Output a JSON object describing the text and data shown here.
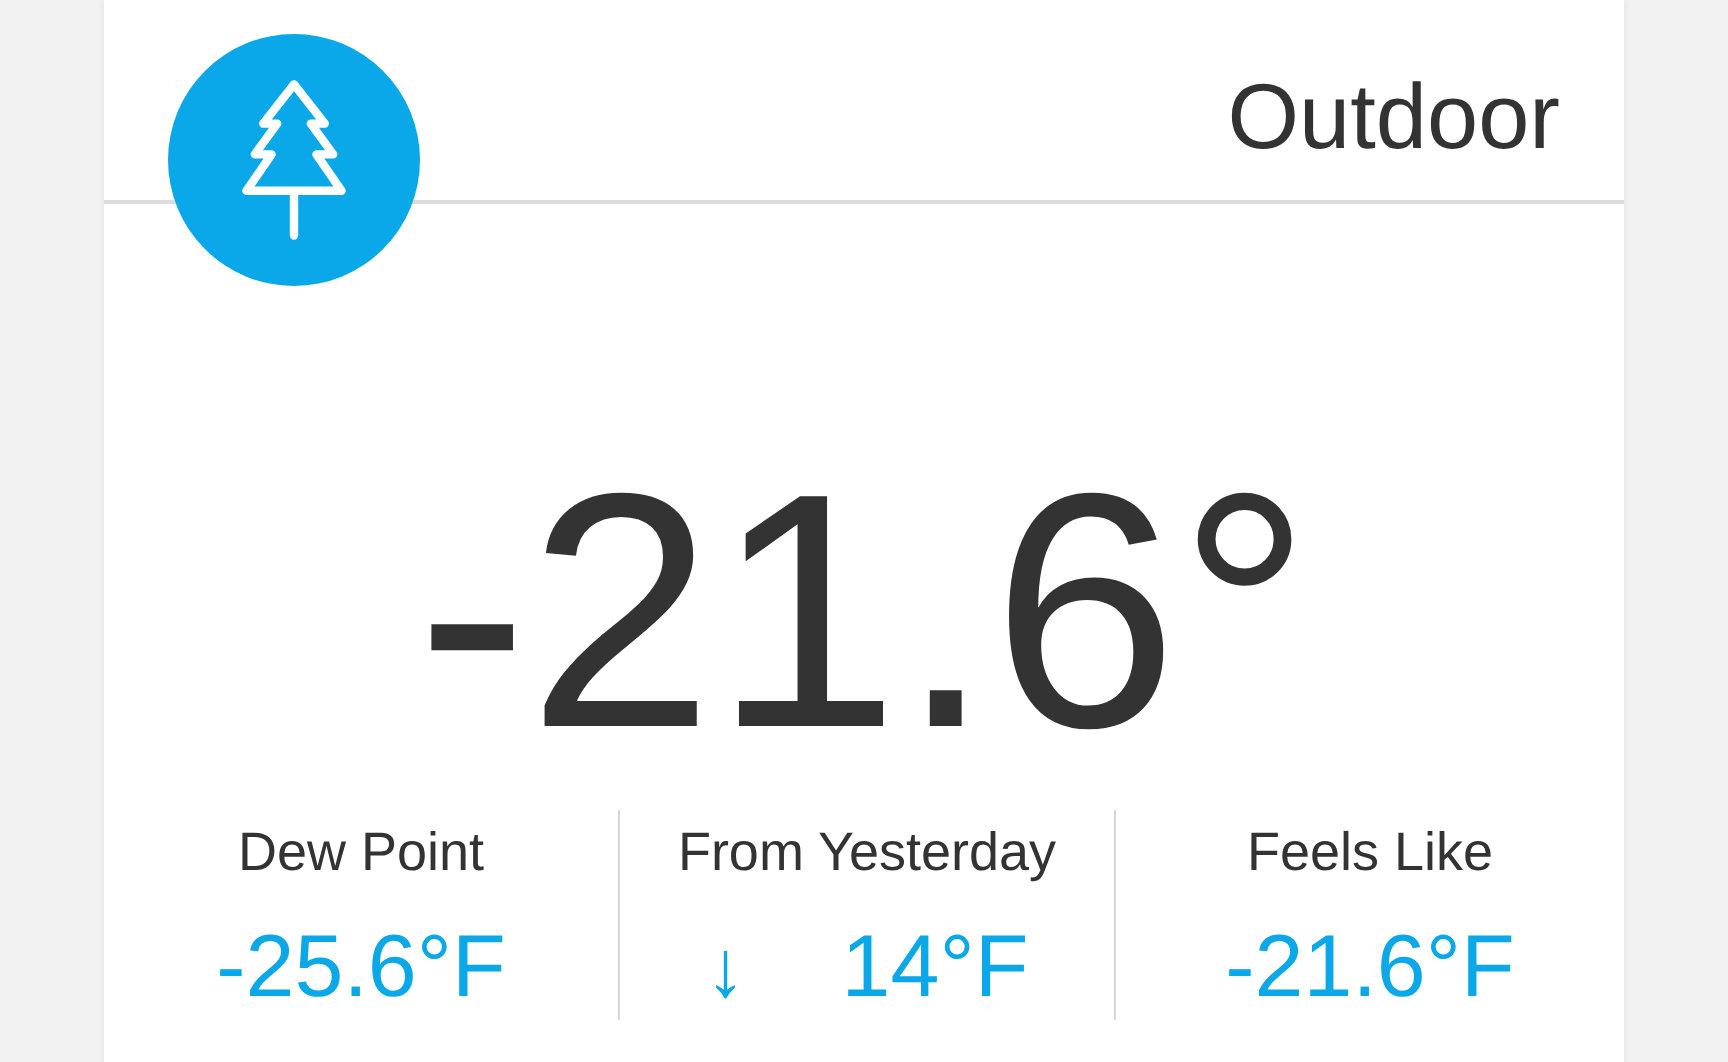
{
  "title": "Outdoor",
  "temperature": "-21.6°",
  "stats": [
    {
      "label": "Dew Point",
      "value": "-25.6°F"
    },
    {
      "label": "From Yesterday",
      "arrow": "↓",
      "value": "14°F"
    },
    {
      "label": "Feels Like",
      "value": "-21.6°F"
    }
  ]
}
